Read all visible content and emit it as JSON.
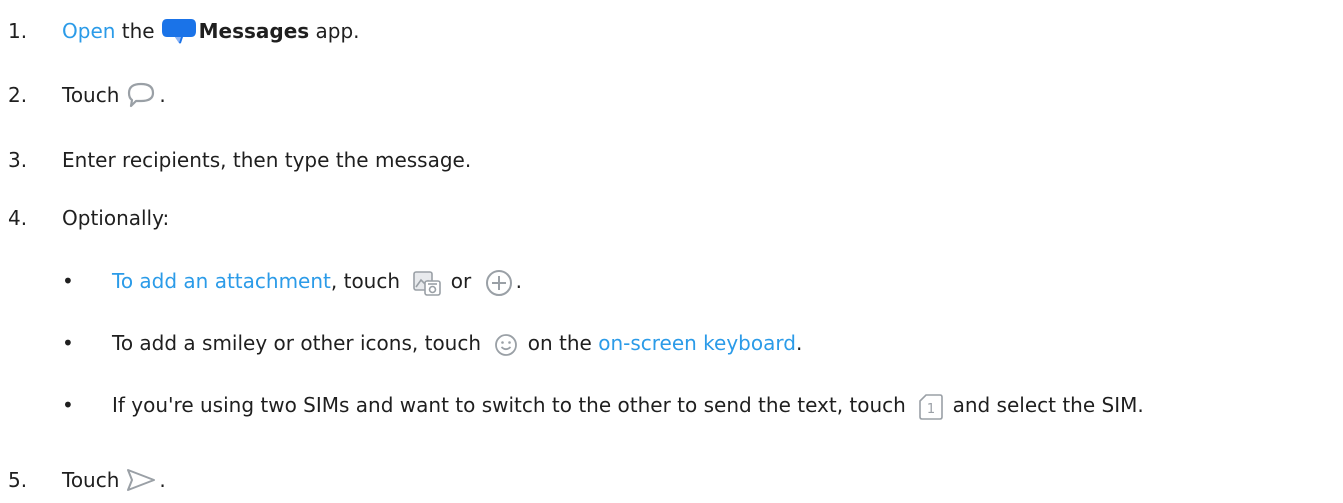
{
  "steps": {
    "s1": {
      "num": "1.",
      "link": "Open",
      "t1": "the",
      "app": "Messages",
      "t2": "app."
    },
    "s2": {
      "num": "2.",
      "t1": "Touch",
      "t2": "."
    },
    "s3": {
      "num": "3.",
      "t1": "Enter recipients, then type the message."
    },
    "s4": {
      "num": "4.",
      "t1": "Optionally:"
    },
    "s5": {
      "num": "5.",
      "t1": "Touch",
      "t2": "."
    }
  },
  "bullets": {
    "b1": {
      "link": "To add an attachment",
      "t1": ", touch",
      "t2": "or",
      "t3": "."
    },
    "b2": {
      "t1": "To add a smiley or other icons, touch",
      "t2": "on the",
      "link": "on-screen keyboard",
      "t3": "."
    },
    "b3": {
      "t1": "If you're using two SIMs and want to switch to the other to send the text, touch",
      "sim": "1",
      "t2": "and select the SIM."
    }
  },
  "icons": {
    "messages_app": "messages-app-icon",
    "new_chat": "chat-bubble-icon",
    "gallery": "gallery-icon",
    "plus": "plus-circle-icon",
    "smiley": "smiley-icon",
    "sim": "sim-icon",
    "send": "send-icon"
  },
  "colors": {
    "link": "#2b9be8",
    "app_icon": "#1a73e8",
    "icon_gray": "#9aa0a6"
  }
}
